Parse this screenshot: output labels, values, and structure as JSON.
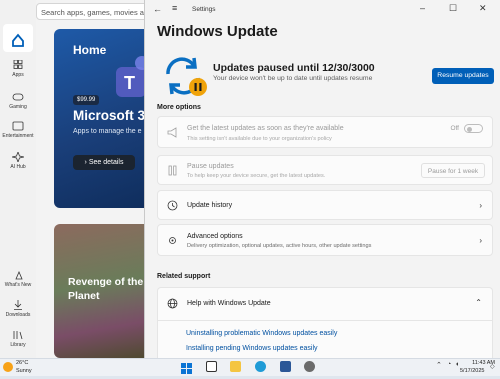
{
  "store": {
    "search_placeholder": "Search apps, games, movies and",
    "rail": [
      {
        "label": "",
        "icon": "home-icon"
      },
      {
        "label": "Apps",
        "icon": "apps-icon"
      },
      {
        "label": "Gaming",
        "icon": "gaming-icon"
      },
      {
        "label": "Entertainment",
        "icon": "entertainment-icon"
      },
      {
        "label": "AI Hub",
        "icon": "ai-hub-icon"
      },
      {
        "label": "What's New",
        "icon": "whats-new-icon"
      },
      {
        "label": "Downloads",
        "icon": "downloads-icon"
      },
      {
        "label": "Library",
        "icon": "library-icon"
      }
    ],
    "hero": {
      "heading": "Home",
      "price": "$99.99",
      "title": "Microsoft 3",
      "subtitle": "Apps to manage the e",
      "button": "See details"
    },
    "game": {
      "title_line1": "Revenge of the S",
      "title_line2": "Planet"
    }
  },
  "settings": {
    "window_title": "Settings",
    "page_title": "Windows Update",
    "status": {
      "title": "Updates paused until 12/30/3000",
      "subtitle": "Your device won't be up to date until updates resume",
      "resume_button": "Resume updates"
    },
    "more_options_label": "More options",
    "options": {
      "latest": {
        "title": "Get the latest updates as soon as they're available",
        "subtitle": "This setting isn't available due to your organization's policy",
        "toggle_label": "Off"
      },
      "pause": {
        "title": "Pause updates",
        "subtitle": "To help keep your device secure, get the latest updates.",
        "select_value": "Pause for 1 week"
      },
      "history": {
        "title": "Update history"
      },
      "advanced": {
        "title": "Advanced options",
        "subtitle": "Delivery optimization, optional updates, active hours, other update settings"
      }
    },
    "related_support_label": "Related support",
    "help": {
      "title": "Help with Windows Update",
      "links": [
        "Uninstalling problematic Windows updates easily",
        "Installing pending Windows updates easily"
      ]
    }
  },
  "taskbar": {
    "weather_temp": "26°C",
    "weather_desc": "Sunny",
    "time": "11:43 AM",
    "date": "5/17/2025"
  },
  "colors": {
    "accent": "#005fb8",
    "paused_badge": "#f0a30a"
  }
}
